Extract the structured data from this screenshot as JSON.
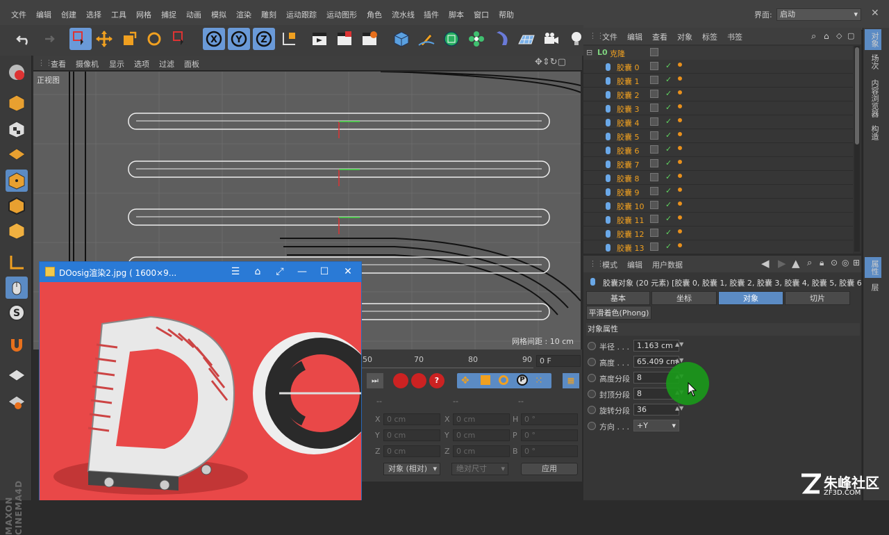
{
  "menubar": {
    "items": [
      "文件",
      "编辑",
      "创建",
      "选择",
      "工具",
      "网格",
      "捕捉",
      "动画",
      "模拟",
      "渲染",
      "雕刻",
      "运动跟踪",
      "运动图形",
      "角色",
      "流水线",
      "插件",
      "脚本",
      "窗口",
      "帮助"
    ],
    "interface_label": "界面:",
    "interface_value": "启动"
  },
  "viewport": {
    "menu": [
      "查看",
      "摄像机",
      "显示",
      "选项",
      "过滤",
      "面板"
    ],
    "label": "正视图",
    "grid_spacing": "网格间距 : 10 cm"
  },
  "timeline": {
    "ticks": [
      "50",
      "70",
      "80",
      "90"
    ],
    "frame": "0 F"
  },
  "coords": {
    "headers": [
      "--",
      "--",
      "--"
    ],
    "rows": [
      {
        "a": "X",
        "av": "0 cm",
        "b": "X",
        "bv": "0 cm",
        "c": "H",
        "cv": "0 °"
      },
      {
        "a": "Y",
        "av": "0 cm",
        "b": "Y",
        "bv": "0 cm",
        "c": "P",
        "cv": "0 °"
      },
      {
        "a": "Z",
        "av": "0 cm",
        "b": "Z",
        "bv": "0 cm",
        "c": "B",
        "cv": "0 °"
      }
    ],
    "mode": "对象 (相对)",
    "size_mode": "绝对尺寸",
    "apply": "应用"
  },
  "objects": {
    "menu": [
      "文件",
      "编辑",
      "查看",
      "对象",
      "标签",
      "书签"
    ],
    "root": "克隆",
    "items": [
      "胶囊 0",
      "胶囊 1",
      "胶囊 2",
      "胶囊 3",
      "胶囊 4",
      "胶囊 5",
      "胶囊 6",
      "胶囊 7",
      "胶囊 8",
      "胶囊 9",
      "胶囊 10",
      "胶囊 11",
      "胶囊 12",
      "胶囊 13"
    ]
  },
  "attributes": {
    "menu": [
      "模式",
      "编辑",
      "用户数据"
    ],
    "header": "胶囊对象 (20 元素) [胶囊 0, 胶囊 1, 胶囊 2, 胶囊 3, 胶囊 4, 胶囊 5, 胶囊 6, 胶",
    "tabs": [
      "基本",
      "坐标",
      "对象",
      "切片"
    ],
    "active_tab": "对象",
    "phong": "平滑着色(Phong)",
    "section": "对象属性",
    "props": [
      {
        "label": "半径 . . .",
        "value": "1.163 cm"
      },
      {
        "label": "高度 . . .",
        "value": "65.409 cm"
      },
      {
        "label": "高度分段",
        "value": "8"
      },
      {
        "label": "封顶分段",
        "value": "8"
      },
      {
        "label": "旋转分段",
        "value": "36"
      },
      {
        "label": "方向 . . .",
        "value": "+Y"
      }
    ]
  },
  "right_tabs": [
    "对象",
    "场次",
    "内容浏览器",
    "构造",
    "属性",
    "层"
  ],
  "image_viewer": {
    "title": "DOosig渲染2.jpg ( 1600×9..."
  },
  "brand": {
    "logo_text": "MAXON CINEMA4D"
  },
  "watermark": {
    "name": "朱峰社区",
    "url": "ZF3D.COM"
  },
  "colors": {
    "accent": "#5b8bc4",
    "object_name": "#f0a020",
    "viewer_bg": "#e84545"
  }
}
